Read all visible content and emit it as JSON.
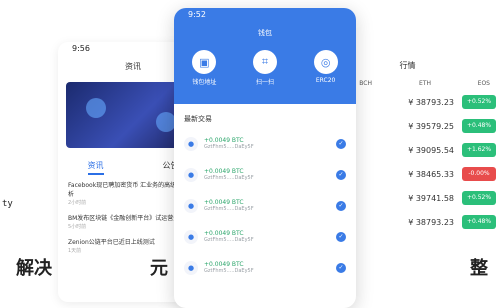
{
  "left_phone": {
    "time": "9:56",
    "title": "资讯",
    "tabs": [
      "资讯",
      "公告"
    ],
    "news": [
      {
        "title": "Facebook现已聘加密货币 汇业务的高级数据分析",
        "meta": "2小时前"
      },
      {
        "title": "BM发布区块链《金融创新平台》试运营全面上线",
        "meta": "5小时前"
      },
      {
        "title": "Zenion公链平台已近日上线测试",
        "meta": "1天前"
      }
    ]
  },
  "center_phone": {
    "time": "9:52",
    "title": "钱包",
    "actions": [
      {
        "label": "钱包地址",
        "icon": "wallet-icon"
      },
      {
        "label": "扫一扫",
        "icon": "scan-icon"
      },
      {
        "label": "ERC20",
        "icon": "token-icon"
      }
    ],
    "section": "最新交易",
    "transactions": [
      {
        "amount": "+0.0049 BTC",
        "addr": "GztFhm5.....DaEy5F"
      },
      {
        "amount": "+0.0049 BTC",
        "addr": "GztFhm5.....DaEy5F"
      },
      {
        "amount": "+0.0049 BTC",
        "addr": "GztFhm5.....DaEy5F"
      },
      {
        "amount": "+0.0049 BTC",
        "addr": "GztFhm5.....DaEy5F"
      },
      {
        "amount": "+0.0049 BTC",
        "addr": "GztFhm5.....DaEy5F"
      }
    ]
  },
  "right_phone": {
    "title": "行情",
    "header": [
      "BCH",
      "ETH",
      "EOS"
    ],
    "quotes": [
      {
        "price": "¥ 38793.23",
        "change": "+0.52%",
        "color": "#2bbf7a"
      },
      {
        "price": "¥ 39579.25",
        "change": "+0.48%",
        "color": "#2bbf7a"
      },
      {
        "price": "¥ 39095.54",
        "change": "+1.62%",
        "color": "#2bbf7a"
      },
      {
        "price": "¥ 38465.33",
        "change": "-0.00%",
        "color": "#e84c4c"
      },
      {
        "price": "¥ 39741.58",
        "change": "+0.52%",
        "color": "#2bbf7a"
      },
      {
        "price": "¥ 38793.23",
        "change": "+0.48%",
        "color": "#2bbf7a"
      }
    ]
  },
  "overlay": {
    "partial_word": "ty",
    "caption_left": "解决",
    "caption_mid": "元",
    "caption_right": "整"
  }
}
